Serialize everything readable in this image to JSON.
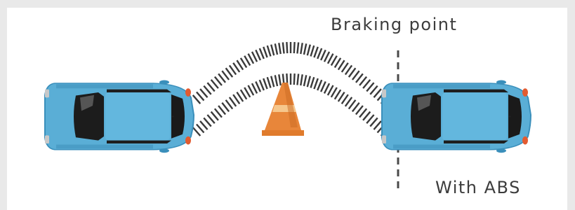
{
  "labels": {
    "braking_point": "Braking point",
    "mode": "With ABS"
  },
  "colors": {
    "background": "#e9e9e9",
    "panel": "#ffffff",
    "car_body": "#5aaed6",
    "car_dark": "#2f84b0",
    "window": "#1a1a1a",
    "cone": "#e07b2c",
    "cone_stripe": "#f6c78c",
    "skid_marks": "#3a3a3a",
    "braking_line": "#4a4a4a",
    "text": "#3c3c3c"
  },
  "icons": {
    "car_start": "car-top-view-icon",
    "car_end": "car-top-view-icon",
    "obstacle": "traffic-cone-icon"
  }
}
